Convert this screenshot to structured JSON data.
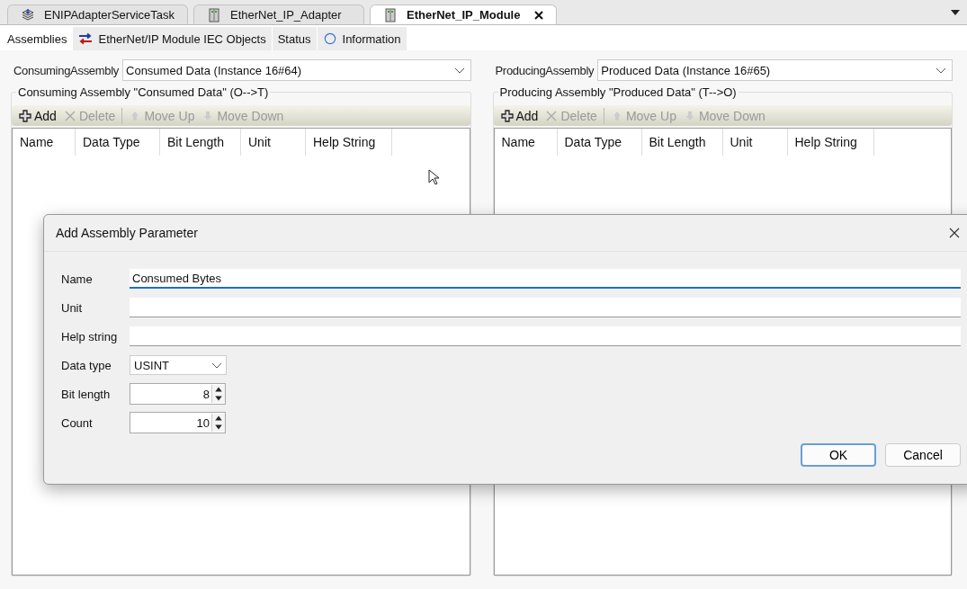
{
  "editor_tabs": [
    {
      "label": "ENIPAdapterServiceTask",
      "kind": "task",
      "selected": false
    },
    {
      "label": "EtherNet_IP_Adapter",
      "kind": "device",
      "selected": false
    },
    {
      "label": "EtherNet_IP_Module",
      "kind": "device",
      "selected": true
    }
  ],
  "sub_tabs": [
    {
      "label": "Assemblies",
      "kind": "plain",
      "selected": true
    },
    {
      "label": "EtherNet/IP Module IEC Objects",
      "kind": "mapping",
      "selected": false
    },
    {
      "label": "Status",
      "kind": "plain",
      "selected": false
    },
    {
      "label": "Information",
      "kind": "info",
      "selected": false
    }
  ],
  "panels": [
    {
      "assembly_label": "ConsumingAssembly",
      "assembly_value": "Consumed Data (Instance 16#64)",
      "group_title": "Consuming Assembly \"Consumed Data\" (O-->T)",
      "toolbar": [
        {
          "label": "Add",
          "kind": "add",
          "disabled": false
        },
        {
          "label": "Delete",
          "kind": "delete",
          "disabled": true
        },
        {
          "label": "Move Up",
          "kind": "up",
          "disabled": true
        },
        {
          "label": "Move Down",
          "kind": "down",
          "disabled": true
        }
      ],
      "columns": [
        "Name",
        "Data Type",
        "Bit Length",
        "Unit",
        "Help String"
      ]
    },
    {
      "assembly_label": "ProducingAssembly",
      "assembly_value": "Produced Data (Instance 16#65)",
      "group_title": "Producing Assembly \"Produced Data\" (T-->O)",
      "toolbar": [
        {
          "label": "Add",
          "kind": "add",
          "disabled": false
        },
        {
          "label": "Delete",
          "kind": "delete",
          "disabled": true
        },
        {
          "label": "Move Up",
          "kind": "up",
          "disabled": true
        },
        {
          "label": "Move Down",
          "kind": "down",
          "disabled": true
        }
      ],
      "columns": [
        "Name",
        "Data Type",
        "Bit Length",
        "Unit",
        "Help String"
      ]
    }
  ],
  "dialog": {
    "title": "Add Assembly Parameter",
    "fields": [
      {
        "label": "Name",
        "kind": "text",
        "value": "Consumed Bytes",
        "focused": true
      },
      {
        "label": "Unit",
        "kind": "text",
        "focused": false
      },
      {
        "label": "Help string",
        "kind": "text",
        "focused": false
      },
      {
        "label": "Data type",
        "kind": "select",
        "value": "USINT",
        "focused": false
      },
      {
        "label": "Bit length",
        "kind": "spin",
        "value": "8",
        "focused": false
      },
      {
        "label": "Count",
        "kind": "spin",
        "value": "10",
        "focused": false
      }
    ],
    "buttons": [
      {
        "label": "OK",
        "default": true
      },
      {
        "label": "Cancel",
        "default": false
      }
    ]
  }
}
